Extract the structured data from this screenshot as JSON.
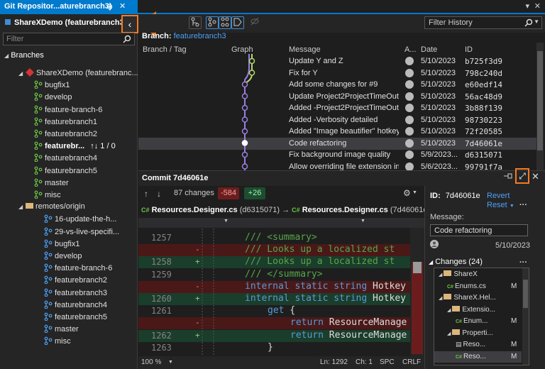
{
  "window": {
    "tab_title": "Git Repositor...aturebranch3)",
    "pin_glyph": "⊕",
    "close_glyph": "✕",
    "more_glyph": "▾",
    "window_close_glyph": "✕"
  },
  "left_panel": {
    "repo_title": "ShareXDemo (featurebranch3)",
    "filter_placeholder": "Filter",
    "collapse_glyph": "‹",
    "branches_header": "Branches",
    "local_root": "ShareXDemo (featurebranc...",
    "local_branches": [
      {
        "label": "bugfix1"
      },
      {
        "label": "develop"
      },
      {
        "label": "feature-branch-6"
      },
      {
        "label": "featurebranch1"
      },
      {
        "label": "featurebranch2"
      },
      {
        "label": "featurebr...",
        "current": true,
        "sync": "↑↓ 1 / 0"
      },
      {
        "label": "featurebranch4"
      },
      {
        "label": "featurebranch5"
      },
      {
        "label": "master"
      },
      {
        "label": "misc"
      }
    ],
    "remote_root": "remotes/origin",
    "remote_branches": [
      {
        "label": "16-update-the-h..."
      },
      {
        "label": "29-vs-live-specifi..."
      },
      {
        "label": "bugfix1"
      },
      {
        "label": "develop"
      },
      {
        "label": "feature-branch-6"
      },
      {
        "label": "featurebranch2"
      },
      {
        "label": "featurebranch3"
      },
      {
        "label": "featurebranch4"
      },
      {
        "label": "featurebranch5"
      },
      {
        "label": "master"
      },
      {
        "label": "misc"
      }
    ]
  },
  "history": {
    "filter_placeholder": "Filter History",
    "branch_label": "Branch:",
    "branch_name": "featurebranch3",
    "columns": {
      "branch_tag": "Branch / Tag",
      "graph": "Graph",
      "message": "Message",
      "author": "A...",
      "date": "Date",
      "id": "ID"
    },
    "commits": [
      {
        "message": "Update Y and Z",
        "date": "5/10/2023",
        "id": "b725f3d9"
      },
      {
        "message": "Fix for Y",
        "date": "5/10/2023",
        "id": "798c240d"
      },
      {
        "message": "Add some changes for #9",
        "date": "5/10/2023",
        "id": "e60edf14"
      },
      {
        "message": "Update Project2ProjectTimeOut...",
        "date": "5/10/2023",
        "id": "56ac48d9"
      },
      {
        "message": "Added -Project2ProjectTimeOut...",
        "date": "5/10/2023",
        "id": "3b88f139"
      },
      {
        "message": "Added -Verbosity detailed",
        "date": "5/10/2023",
        "id": "98730223"
      },
      {
        "message": "Added \"Image beautifier\" hotkey",
        "date": "5/10/2023",
        "id": "72f20585"
      },
      {
        "message": "Code refactoring",
        "date": "5/10/2023",
        "id": "7d46061e",
        "selected": true
      },
      {
        "message": "Fix background image quality",
        "date": "5/9/2023...",
        "id": "d6315071"
      },
      {
        "message": "Allow overriding file extension in...",
        "date": "5/6/2023...",
        "id": "99791f7a"
      }
    ]
  },
  "commit_detail": {
    "title": "Commit 7d46061e",
    "changes_label": "87 changes",
    "deletions": "-584",
    "additions": "+26",
    "left_file": "Resources.Designer.cs",
    "left_hash": "(d6315071)",
    "right_file": "Resources.Designer.cs",
    "right_hash": "(7d46061e)",
    "expand_glyph": "⤢",
    "close_glyph": "✕"
  },
  "diff": {
    "lines": [
      {
        "ln": "1257",
        "kind": "ctx",
        "code": "/// <summary>"
      },
      {
        "ln": "",
        "kind": "del",
        "code": "///   Looks up a localized st"
      },
      {
        "ln": "1258",
        "kind": "add",
        "code": "///   Looks up a localized st"
      },
      {
        "ln": "1259",
        "kind": "ctx",
        "code": "/// </summary>"
      },
      {
        "ln": "",
        "kind": "del",
        "code": "internal static string Hotkey"
      },
      {
        "ln": "1260",
        "kind": "add",
        "code": "internal static string Hotkey"
      },
      {
        "ln": "1261",
        "kind": "ctx",
        "code": "get {"
      },
      {
        "ln": "",
        "kind": "del",
        "code": "return ResourceManage"
      },
      {
        "ln": "1262",
        "kind": "add",
        "code": "return ResourceManage"
      },
      {
        "ln": "1263",
        "kind": "ctx",
        "code": "}"
      }
    ],
    "status": {
      "zoom": "100 %",
      "line": "Ln: 1292",
      "col": "Ch: 1",
      "spc": "SPC",
      "eol": "CRLF"
    }
  },
  "detail_panel": {
    "id_label": "ID:",
    "id_value": "7d46061e",
    "revert": "Revert",
    "reset": "Reset",
    "message_label": "Message:",
    "message_value": "Code refactoring",
    "date": "5/10/2023",
    "changes_header": "Changes (24)",
    "tree": [
      {
        "label": "ShareX",
        "type": "folder",
        "indent": 0
      },
      {
        "label": "Enums.cs",
        "type": "file",
        "indent": 1,
        "status": "M"
      },
      {
        "label": "ShareX.Hel...",
        "type": "folder",
        "indent": 0
      },
      {
        "label": "Extensio...",
        "type": "folder",
        "indent": 1
      },
      {
        "label": "Enum...",
        "type": "file",
        "indent": 2,
        "status": "M"
      },
      {
        "label": "Properti...",
        "type": "folder",
        "indent": 1
      },
      {
        "label": "Reso...",
        "type": "file2",
        "indent": 2,
        "status": "M"
      },
      {
        "label": "Reso...",
        "type": "file",
        "indent": 2,
        "status": "M",
        "selected": true
      }
    ]
  },
  "colors": {
    "accent": "#007acc",
    "highlight": "#f47b20",
    "branch_blue": "#4ea1f3",
    "graph_purple": "#9b7ee0",
    "graph_green": "#b5d96b"
  }
}
